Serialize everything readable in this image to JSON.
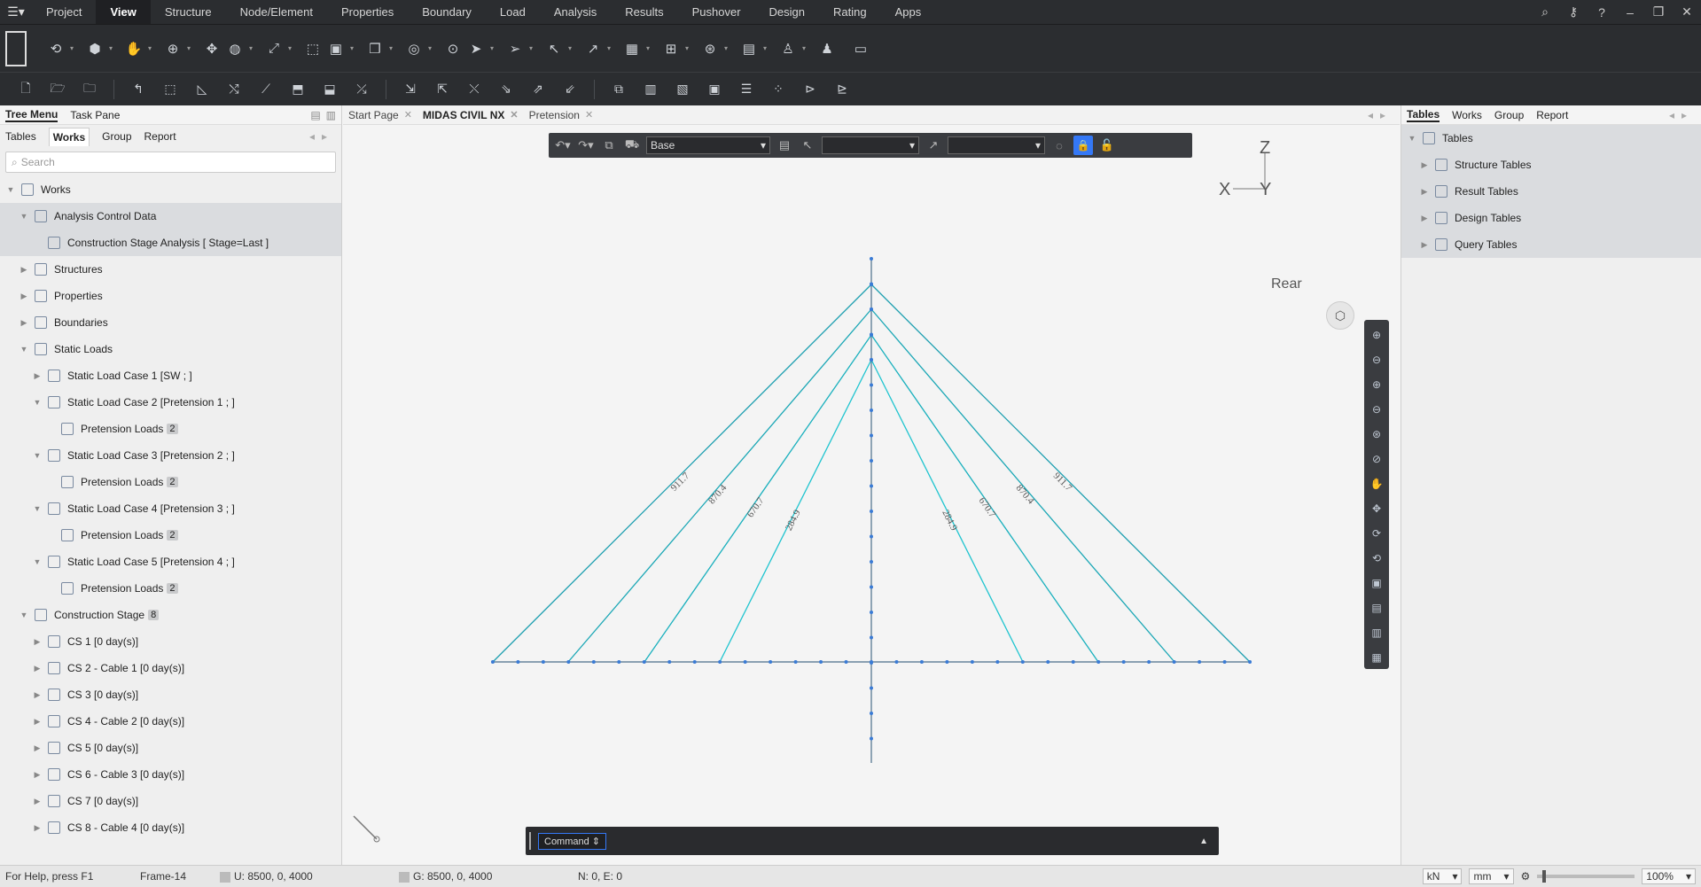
{
  "menu": {
    "items": [
      "Project",
      "View",
      "Structure",
      "Node/Element",
      "Properties",
      "Boundary",
      "Load",
      "Analysis",
      "Results",
      "Pushover",
      "Design",
      "Rating",
      "Apps"
    ],
    "active": "View"
  },
  "left_panel": {
    "tabs": [
      "Tree Menu",
      "Task Pane"
    ],
    "subtabs": [
      "Tables",
      "Works",
      "Group",
      "Report"
    ],
    "search_placeholder": "Search",
    "tree": [
      {
        "label": "Works",
        "level": 0,
        "exp": "▼"
      },
      {
        "label": "Analysis Control Data",
        "level": 1,
        "exp": "▼",
        "selected": true
      },
      {
        "label": "Construction Stage Analysis [ Stage=Last ]",
        "level": 2,
        "exp": "",
        "selected": true
      },
      {
        "label": "Structures",
        "level": 1,
        "exp": "▶"
      },
      {
        "label": "Properties",
        "level": 1,
        "exp": "▶"
      },
      {
        "label": "Boundaries",
        "level": 1,
        "exp": "▶"
      },
      {
        "label": "Static Loads",
        "level": 1,
        "exp": "▼"
      },
      {
        "label": "Static Load Case 1 [SW ; ]",
        "level": 2,
        "exp": "▶"
      },
      {
        "label": "Static Load Case 2 [Pretension 1 ; ]",
        "level": 2,
        "exp": "▼"
      },
      {
        "label": "Pretension Loads",
        "level": 3,
        "exp": "",
        "badge": "2"
      },
      {
        "label": "Static Load Case 3 [Pretension 2 ; ]",
        "level": 2,
        "exp": "▼"
      },
      {
        "label": "Pretension Loads",
        "level": 3,
        "exp": "",
        "badge": "2"
      },
      {
        "label": "Static Load Case 4 [Pretension 3 ; ]",
        "level": 2,
        "exp": "▼"
      },
      {
        "label": "Pretension Loads",
        "level": 3,
        "exp": "",
        "badge": "2"
      },
      {
        "label": "Static Load Case 5 [Pretension 4 ; ]",
        "level": 2,
        "exp": "▼"
      },
      {
        "label": "Pretension Loads",
        "level": 3,
        "exp": "",
        "badge": "2"
      },
      {
        "label": "Construction Stage",
        "level": 1,
        "exp": "▼",
        "badge": "8"
      },
      {
        "label": "CS 1 [0 day(s)]",
        "level": 2,
        "exp": "▶"
      },
      {
        "label": "CS 2 - Cable 1 [0 day(s)]",
        "level": 2,
        "exp": "▶"
      },
      {
        "label": "CS 3 [0 day(s)]",
        "level": 2,
        "exp": "▶"
      },
      {
        "label": "CS 4 - Cable 2 [0 day(s)]",
        "level": 2,
        "exp": "▶"
      },
      {
        "label": "CS 5 [0 day(s)]",
        "level": 2,
        "exp": "▶"
      },
      {
        "label": "CS 6 - Cable 3 [0 day(s)]",
        "level": 2,
        "exp": "▶"
      },
      {
        "label": "CS 7 [0 day(s)]",
        "level": 2,
        "exp": "▶"
      },
      {
        "label": "CS 8 - Cable 4 [0 day(s)]",
        "level": 2,
        "exp": "▶"
      }
    ]
  },
  "doc_tabs": [
    "Start Page",
    "MIDAS CIVIL NX",
    "Pretension"
  ],
  "doc_tabs_active": "MIDAS CIVIL NX",
  "viewport_toolbar": {
    "view_select": "Base",
    "select2": "",
    "select3": ""
  },
  "viewport": {
    "axis": {
      "z": "Z",
      "x": "X",
      "y": "Y"
    },
    "view_label": "Rear",
    "cable_values": [
      "911.7",
      "870.4",
      "670.7",
      "284.9"
    ],
    "cable_color": "#1aa7b5",
    "member_color": "#4a6e8a"
  },
  "command": {
    "label": "Command"
  },
  "right_panel": {
    "tabs": [
      "Tables",
      "Works",
      "Group",
      "Report"
    ],
    "root": "Tables",
    "items": [
      "Structure Tables",
      "Result Tables",
      "Design Tables",
      "Query Tables"
    ]
  },
  "status": {
    "help": "For Help, press F1",
    "frame": "Frame-14",
    "u": "U: 8500, 0, 4000",
    "g": "G: 8500, 0, 4000",
    "ne": "N: 0, E: 0",
    "force_unit": "kN",
    "length_unit": "mm",
    "zoom": "100%"
  }
}
